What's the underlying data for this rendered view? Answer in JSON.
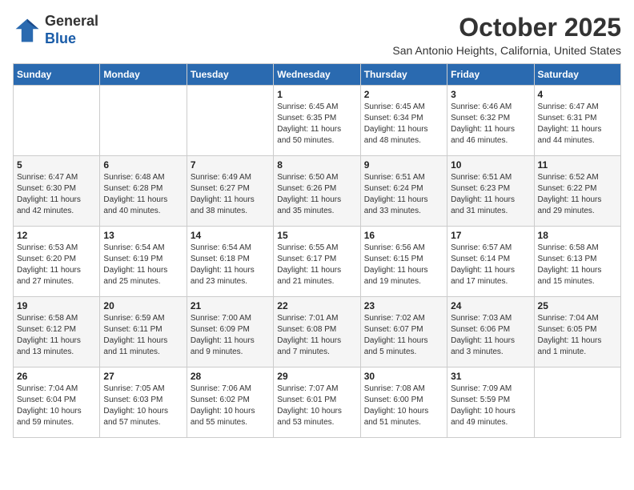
{
  "header": {
    "logo_general": "General",
    "logo_blue": "Blue",
    "month_title": "October 2025",
    "location": "San Antonio Heights, California, United States"
  },
  "calendar": {
    "headers": [
      "Sunday",
      "Monday",
      "Tuesday",
      "Wednesday",
      "Thursday",
      "Friday",
      "Saturday"
    ],
    "weeks": [
      [
        {
          "day": "",
          "info": ""
        },
        {
          "day": "",
          "info": ""
        },
        {
          "day": "",
          "info": ""
        },
        {
          "day": "1",
          "info": "Sunrise: 6:45 AM\nSunset: 6:35 PM\nDaylight: 11 hours\nand 50 minutes."
        },
        {
          "day": "2",
          "info": "Sunrise: 6:45 AM\nSunset: 6:34 PM\nDaylight: 11 hours\nand 48 minutes."
        },
        {
          "day": "3",
          "info": "Sunrise: 6:46 AM\nSunset: 6:32 PM\nDaylight: 11 hours\nand 46 minutes."
        },
        {
          "day": "4",
          "info": "Sunrise: 6:47 AM\nSunset: 6:31 PM\nDaylight: 11 hours\nand 44 minutes."
        }
      ],
      [
        {
          "day": "5",
          "info": "Sunrise: 6:47 AM\nSunset: 6:30 PM\nDaylight: 11 hours\nand 42 minutes."
        },
        {
          "day": "6",
          "info": "Sunrise: 6:48 AM\nSunset: 6:28 PM\nDaylight: 11 hours\nand 40 minutes."
        },
        {
          "day": "7",
          "info": "Sunrise: 6:49 AM\nSunset: 6:27 PM\nDaylight: 11 hours\nand 38 minutes."
        },
        {
          "day": "8",
          "info": "Sunrise: 6:50 AM\nSunset: 6:26 PM\nDaylight: 11 hours\nand 35 minutes."
        },
        {
          "day": "9",
          "info": "Sunrise: 6:51 AM\nSunset: 6:24 PM\nDaylight: 11 hours\nand 33 minutes."
        },
        {
          "day": "10",
          "info": "Sunrise: 6:51 AM\nSunset: 6:23 PM\nDaylight: 11 hours\nand 31 minutes."
        },
        {
          "day": "11",
          "info": "Sunrise: 6:52 AM\nSunset: 6:22 PM\nDaylight: 11 hours\nand 29 minutes."
        }
      ],
      [
        {
          "day": "12",
          "info": "Sunrise: 6:53 AM\nSunset: 6:20 PM\nDaylight: 11 hours\nand 27 minutes."
        },
        {
          "day": "13",
          "info": "Sunrise: 6:54 AM\nSunset: 6:19 PM\nDaylight: 11 hours\nand 25 minutes."
        },
        {
          "day": "14",
          "info": "Sunrise: 6:54 AM\nSunset: 6:18 PM\nDaylight: 11 hours\nand 23 minutes."
        },
        {
          "day": "15",
          "info": "Sunrise: 6:55 AM\nSunset: 6:17 PM\nDaylight: 11 hours\nand 21 minutes."
        },
        {
          "day": "16",
          "info": "Sunrise: 6:56 AM\nSunset: 6:15 PM\nDaylight: 11 hours\nand 19 minutes."
        },
        {
          "day": "17",
          "info": "Sunrise: 6:57 AM\nSunset: 6:14 PM\nDaylight: 11 hours\nand 17 minutes."
        },
        {
          "day": "18",
          "info": "Sunrise: 6:58 AM\nSunset: 6:13 PM\nDaylight: 11 hours\nand 15 minutes."
        }
      ],
      [
        {
          "day": "19",
          "info": "Sunrise: 6:58 AM\nSunset: 6:12 PM\nDaylight: 11 hours\nand 13 minutes."
        },
        {
          "day": "20",
          "info": "Sunrise: 6:59 AM\nSunset: 6:11 PM\nDaylight: 11 hours\nand 11 minutes."
        },
        {
          "day": "21",
          "info": "Sunrise: 7:00 AM\nSunset: 6:09 PM\nDaylight: 11 hours\nand 9 minutes."
        },
        {
          "day": "22",
          "info": "Sunrise: 7:01 AM\nSunset: 6:08 PM\nDaylight: 11 hours\nand 7 minutes."
        },
        {
          "day": "23",
          "info": "Sunrise: 7:02 AM\nSunset: 6:07 PM\nDaylight: 11 hours\nand 5 minutes."
        },
        {
          "day": "24",
          "info": "Sunrise: 7:03 AM\nSunset: 6:06 PM\nDaylight: 11 hours\nand 3 minutes."
        },
        {
          "day": "25",
          "info": "Sunrise: 7:04 AM\nSunset: 6:05 PM\nDaylight: 11 hours\nand 1 minute."
        }
      ],
      [
        {
          "day": "26",
          "info": "Sunrise: 7:04 AM\nSunset: 6:04 PM\nDaylight: 10 hours\nand 59 minutes."
        },
        {
          "day": "27",
          "info": "Sunrise: 7:05 AM\nSunset: 6:03 PM\nDaylight: 10 hours\nand 57 minutes."
        },
        {
          "day": "28",
          "info": "Sunrise: 7:06 AM\nSunset: 6:02 PM\nDaylight: 10 hours\nand 55 minutes."
        },
        {
          "day": "29",
          "info": "Sunrise: 7:07 AM\nSunset: 6:01 PM\nDaylight: 10 hours\nand 53 minutes."
        },
        {
          "day": "30",
          "info": "Sunrise: 7:08 AM\nSunset: 6:00 PM\nDaylight: 10 hours\nand 51 minutes."
        },
        {
          "day": "31",
          "info": "Sunrise: 7:09 AM\nSunset: 5:59 PM\nDaylight: 10 hours\nand 49 minutes."
        },
        {
          "day": "",
          "info": ""
        }
      ]
    ]
  }
}
